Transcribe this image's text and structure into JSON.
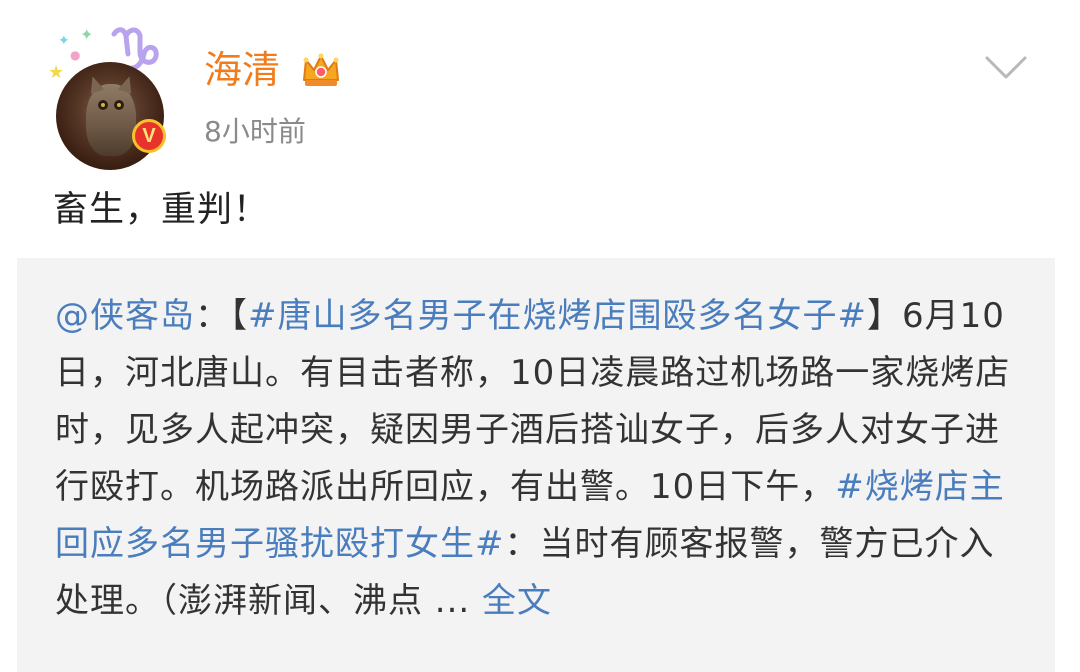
{
  "post": {
    "username": "海清",
    "timestamp": "8小时前",
    "text": "畜生，重判！"
  },
  "repost": {
    "mention": "@侠客岛",
    "colon": "：",
    "bracket_open": "【",
    "hashtag1": "#唐山多名男子在烧烤店围殴多名女子#",
    "bracket_close": "】",
    "body1": "6月10日，河北唐山。有目击者称，10日凌晨路过机场路一家烧烤店时，见多人起冲突，疑因男子酒后搭讪女子，后多人对女子进行殴打。机场路派出所回应，有出警。10日下午，",
    "hashtag2": "#烧烤店主回应多名男子骚扰殴打女生#",
    "body2": "：当时有顾客报警，警方已介入处理。（澎湃新闻、沸点 ... ",
    "full_text_link": "全文"
  },
  "icons": {
    "avatar": "owl-avatar",
    "zodiac": "capricorn-zodiac-icon",
    "verified": "verified-v-icon",
    "verified_letter": "V",
    "crown": "crown-vip-icon",
    "chevron": "chevron-down-icon"
  },
  "colors": {
    "username": "#f07c1d",
    "link": "#4a7dbd",
    "timestamp": "#8a8a8a",
    "repost_bg": "#f3f3f3",
    "verified": "#e8332a"
  }
}
